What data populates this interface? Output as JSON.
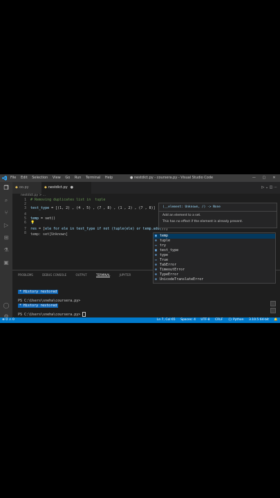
{
  "titlebar": {
    "menu": [
      "File",
      "Edit",
      "Selection",
      "View",
      "Go",
      "Run",
      "Terminal",
      "Help"
    ],
    "window_title": "● nestdict.py - coursera.py - Visual Studio Code",
    "controls": [
      "—",
      "▢",
      "✕"
    ]
  },
  "tabs": [
    {
      "label": "oo.py"
    },
    {
      "label": "nestdict.py",
      "dirty": "●"
    }
  ],
  "breadcrumb": "nestdict.py > ...",
  "editor": {
    "line_numbers": [
      "1",
      "2",
      "3",
      "4",
      "5",
      "6",
      "7",
      "8"
    ],
    "lines": {
      "l1": "# Removing duplicates list in  tuple",
      "l3_var": "test_type",
      "l3_rest": " = [(1, 2) , (4 , 5) , (7 , 8) , (1 , 2) , (7 , 8)]",
      "l5_var": "temp",
      "l5_rest": " = set()",
      "l7_var": "res",
      "l7_a": " = [",
      "l7_b": "ele for ele in test_type if not (tuple(ele) or temp.add(",
      "l7_c": "))]"
    },
    "inline_hint": "temp: set[Unknown]"
  },
  "hover": {
    "signature": "(__element: Unknown, /) -> None",
    "desc1": "Add an element to a set.",
    "desc2": "This has no effect if the element is already present."
  },
  "suggestions": [
    {
      "label": "temp",
      "kind": "var"
    },
    {
      "label": "tuple",
      "kind": "class"
    },
    {
      "label": "try",
      "kind": "kw"
    },
    {
      "label": "test_type",
      "kind": "var"
    },
    {
      "label": "type",
      "kind": "class"
    },
    {
      "label": "True",
      "kind": "kw"
    },
    {
      "label": "TabError",
      "kind": "class"
    },
    {
      "label": "TimeoutError",
      "kind": "class"
    },
    {
      "label": "TypeError",
      "kind": "class"
    },
    {
      "label": "UnicodeTranslateError",
      "kind": "class"
    }
  ],
  "panel": {
    "tabs": [
      "PROBLEMS",
      "DEBUG CONSOLE",
      "OUTPUT",
      "TERMINAL",
      "JUPYTER"
    ],
    "active_tab": "TERMINAL",
    "history1": "History restored",
    "prompt1": "PS C:\\Users\\sneha\\coursera.py>",
    "history2": "History restored",
    "prompt2": "PS C:\\Users\\sneha\\coursera.py> "
  },
  "statusbar": {
    "left": "⊗ 0 ⚠ 0",
    "right": [
      "Ln 7, Col 65",
      "Spaces: 4",
      "UTF-8",
      "CRLF",
      "{} Python",
      "3.10.5 64-bit"
    ]
  },
  "colors": {
    "accent": "#007acc",
    "selection": "#04395e",
    "history_badge": "#1066b5"
  }
}
